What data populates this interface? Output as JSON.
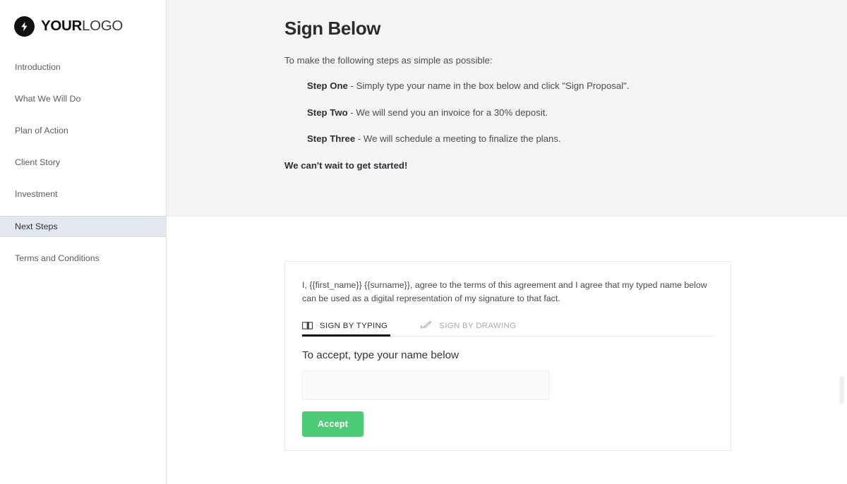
{
  "sidebar": {
    "logo": {
      "icon": "lightning-bolt-icon",
      "text_bold": "YOUR",
      "text_light": "LOGO"
    },
    "items": [
      {
        "label": "Introduction",
        "active": false
      },
      {
        "label": "What We Will Do",
        "active": false
      },
      {
        "label": "Plan of Action",
        "active": false
      },
      {
        "label": "Client Story",
        "active": false
      },
      {
        "label": "Investment",
        "active": false
      },
      {
        "label": "Next Steps",
        "active": true
      },
      {
        "label": "Terms and Conditions",
        "active": false
      }
    ]
  },
  "main": {
    "title": "Sign Below",
    "lead": "To make the following steps as simple as possible:",
    "steps": [
      {
        "name": "Step One",
        "text": " - Simply type your name in the box below and click \"Sign Proposal\"."
      },
      {
        "name": "Step Two",
        "text": " - We will send you an invoice for a 30% deposit."
      },
      {
        "name": "Step Three",
        "text": " - We will schedule a meeting to finalize the plans."
      }
    ],
    "closing": "We can't wait to get started!"
  },
  "sign_card": {
    "legal_text": "I, {{first_name}} {{surname}}, agree to the terms of this agreement and I agree that my typed name below can be used as a digital representation of my signature to that fact.",
    "tabs": [
      {
        "label": "SIGN BY TYPING",
        "icon": "keyboard-icon",
        "active": true
      },
      {
        "label": "SIGN BY DRAWING",
        "icon": "pen-signature-icon",
        "active": false
      }
    ],
    "accept_label": "To accept, type your name below",
    "name_input": {
      "value": "",
      "placeholder": ""
    },
    "accept_button": "Accept"
  },
  "colors": {
    "accent_green": "#4ecb77",
    "active_nav": "#e3e7ee",
    "band_gray": "#f4f4f4",
    "tab_underline": "#111111"
  }
}
